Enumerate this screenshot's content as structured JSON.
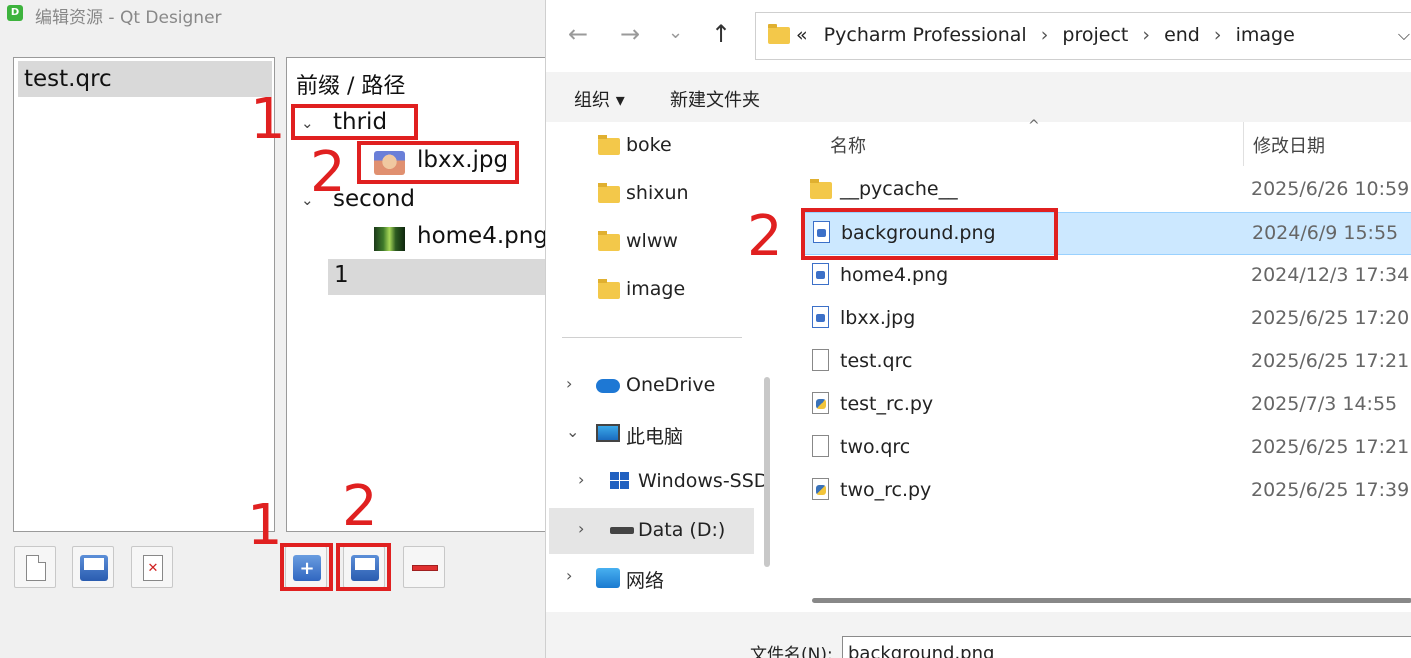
{
  "qt": {
    "app_icon": "D",
    "window_title": "编辑资源 - Qt Designer",
    "qrc_files": [
      "test.qrc"
    ],
    "tree_header": "前缀 / 路径",
    "tree": [
      {
        "chevron": "⌄",
        "label": "thrid"
      },
      {
        "label": "lbxx.jpg",
        "icon": "avatar-thumbnail"
      },
      {
        "chevron": "⌄",
        "label": "second"
      },
      {
        "label": "home4.png",
        "icon": "forest-thumbnail"
      },
      {
        "label": "1"
      }
    ],
    "buttons": [
      "new-file-icon",
      "save-icon",
      "remove-file-icon",
      "add-folder-icon",
      "add-files-icon",
      "remove-icon"
    ]
  },
  "annotations": {
    "one": "1",
    "two": "2"
  },
  "dialog": {
    "nav": {
      "back": "←",
      "forward": "→",
      "recent": "⌄",
      "up": "↑"
    },
    "address": {
      "overflow": "«",
      "separator": "›",
      "crumbs": [
        "Pycharm Professional",
        "project",
        "end",
        "image"
      ],
      "dropdown": "⌵"
    },
    "commands": {
      "organize": "组织 ▾",
      "new_folder": "新建文件夹"
    },
    "nav_pane": {
      "folders": [
        "boke",
        "shixun",
        "wlww",
        "image"
      ],
      "onedrive": "OneDrive",
      "this_pc": "此电脑",
      "windows_ssd": "Windows-SSD",
      "data_d": "Data (D:)",
      "network": "网络",
      "expand": "›",
      "collapse": "⌄"
    },
    "columns": {
      "name": "名称",
      "date": "修改日期",
      "sort": "^"
    },
    "files": [
      {
        "name": "__pycache__",
        "date": "2025/6/26 10:59",
        "type": "folder"
      },
      {
        "name": "background.png",
        "date": "2024/6/9 15:55",
        "type": "image",
        "selected": true
      },
      {
        "name": "home4.png",
        "date": "2024/12/3 17:34",
        "type": "image"
      },
      {
        "name": "lbxx.jpg",
        "date": "2025/6/25 17:20",
        "type": "image"
      },
      {
        "name": "test.qrc",
        "date": "2025/6/25 17:21",
        "type": "file"
      },
      {
        "name": "test_rc.py",
        "date": "2025/7/3 14:55",
        "type": "python"
      },
      {
        "name": "two.qrc",
        "date": "2025/6/25 17:21",
        "type": "file"
      },
      {
        "name": "two_rc.py",
        "date": "2025/6/25 17:39",
        "type": "python"
      }
    ],
    "filename_label": "文件名(N):",
    "filename_value": "background.png"
  },
  "colors": {
    "annotation": "#e02020",
    "selection": "#cce8ff",
    "folder": "#f3c84a"
  }
}
